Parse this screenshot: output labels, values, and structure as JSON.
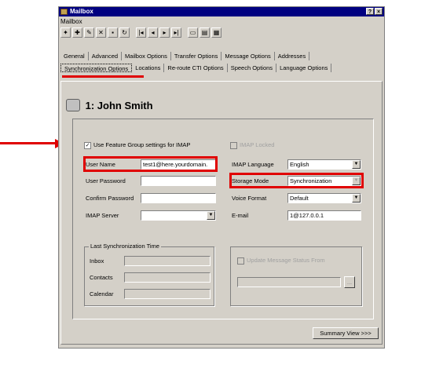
{
  "window": {
    "title": "Mailbox",
    "help_btn": "?",
    "close_btn": "×"
  },
  "menu": {
    "item": "Mailbox"
  },
  "tabs_row1": [
    "General",
    "Advanced",
    "Mailbox Options",
    "Transfer Options",
    "Message Options",
    "Addresses"
  ],
  "tabs_row2": [
    "Synchronization Options",
    "Locations",
    "Re-route CTI Options",
    "Speech Options",
    "Language Options"
  ],
  "heading": "1: John Smith",
  "form": {
    "use_feature_group_label": "Use Feature Group settings for IMAP",
    "imap_locked_label": "IMAP Locked",
    "user_name_label": "User Name",
    "user_name_value": "test1@here.yourdomain.",
    "user_password_label": "User Password",
    "confirm_password_label": "Confirm Password",
    "imap_server_label": "IMAP Server",
    "imap_language_label": "IMAP Language",
    "imap_language_value": "English",
    "storage_mode_label": "Storage Mode",
    "storage_mode_value": "Synchronization",
    "voice_format_label": "Voice Format",
    "voice_format_value": "Default",
    "email_label": "E-mail",
    "email_value": "1@127.0.0.1"
  },
  "sync_group": {
    "title": "Last Synchronization Time",
    "inbox_label": "Inbox",
    "contacts_label": "Contacts",
    "calendar_label": "Calendar"
  },
  "update_status": {
    "label": "Update Message Status From",
    "browse": "..."
  },
  "footer": {
    "summary_button": "Summary View >>>"
  },
  "colors": {
    "highlight": "#e00000",
    "titlebar": "#000080",
    "face": "#d4d0c8"
  }
}
